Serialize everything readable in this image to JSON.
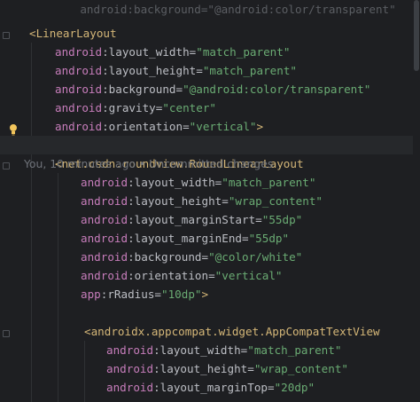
{
  "editor": {
    "faded_top_text": "android:background=\"@android:color/transparent\"",
    "blame": "You, 10 minutes ago • Uncommitted changes",
    "lines": [
      {
        "type": "tag",
        "indent": "<",
        "name": "LinearLayout",
        "close": ""
      },
      {
        "type": "attr",
        "ns": "android",
        "name": "layout_width",
        "value": "\"match_parent\""
      },
      {
        "type": "attr",
        "ns": "android",
        "name": "layout_height",
        "value": "\"match_parent\""
      },
      {
        "type": "attr",
        "ns": "android",
        "name": "background",
        "value": "\"@android:color/transparent\""
      },
      {
        "type": "attr",
        "ns": "android",
        "name": "gravity",
        "value": "\"center\""
      },
      {
        "type": "attr",
        "ns": "android",
        "name": "orientation",
        "value": "\"vertical\"",
        "close": ">"
      },
      {
        "type": "tag",
        "name": "net.csdn.roundview.RoundLinearLayout"
      },
      {
        "type": "attr",
        "ns": "android",
        "name": "layout_width",
        "value": "\"match_parent\""
      },
      {
        "type": "attr",
        "ns": "android",
        "name": "layout_height",
        "value": "\"wrap_content\""
      },
      {
        "type": "attr",
        "ns": "android",
        "name": "layout_marginStart",
        "value": "\"55dp\""
      },
      {
        "type": "attr",
        "ns": "android",
        "name": "layout_marginEnd",
        "value": "\"55dp\""
      },
      {
        "type": "attr",
        "ns": "android",
        "name": "background",
        "value": "\"@color/white\""
      },
      {
        "type": "attr",
        "ns": "android",
        "name": "orientation",
        "value": "\"vertical\""
      },
      {
        "type": "attr",
        "ns": "app",
        "name": "rRadius",
        "value": "\"10dp\"",
        "close": ">"
      },
      {
        "type": "tag",
        "name": "androidx.appcompat.widget.AppCompatTextView"
      },
      {
        "type": "attr",
        "ns": "android",
        "name": "layout_width",
        "value": "\"match_parent\""
      },
      {
        "type": "attr",
        "ns": "android",
        "name": "layout_height",
        "value": "\"wrap_content\""
      },
      {
        "type": "attr",
        "ns": "android",
        "name": "layout_marginTop",
        "value": "\"20dp\""
      }
    ]
  },
  "colors": {
    "background": "#1e1f22",
    "tag": "#d5b778",
    "namespace": "#c77dbb",
    "attribute": "#bcbec4",
    "value": "#6aab73",
    "blame_text": "#6f737a",
    "bulb": "#f2c55c"
  },
  "icons": {
    "gutter_bulb": "lightbulb-icon",
    "fold_marker": "fold-icon"
  }
}
